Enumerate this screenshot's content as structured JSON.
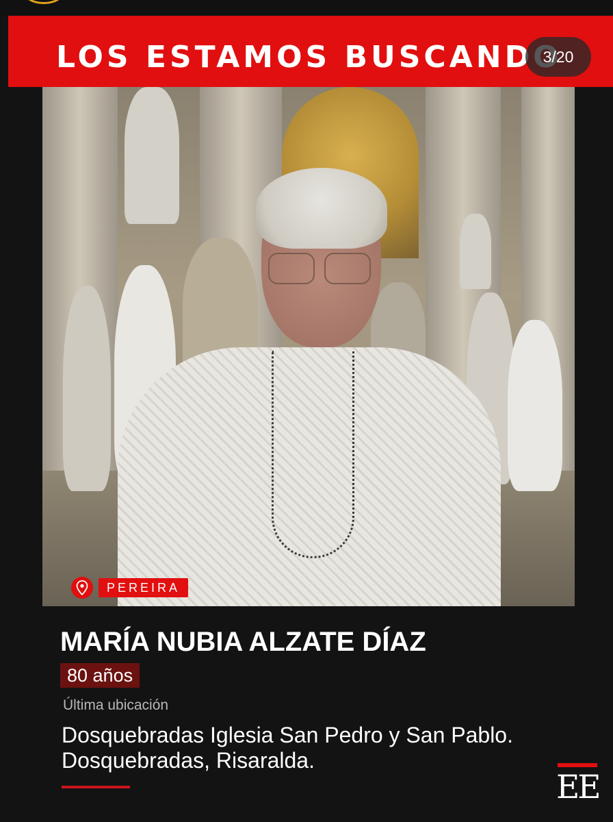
{
  "banner": {
    "title": "LOS ESTAMOS BUSCANDO"
  },
  "gallery": {
    "counter": "3/20"
  },
  "location": {
    "city": "PEREIRA",
    "icon": "map-pin-icon"
  },
  "person": {
    "name": "MARÍA NUBIA ALZATE DÍAZ",
    "age": "80 años",
    "last_location_label": "Última ubicación",
    "last_location": "Dosquebradas Iglesia San Pedro y San Pablo. Dosquebradas, Risaralda."
  },
  "brand": {
    "logo_text": "EE"
  },
  "colors": {
    "accent": "#e10f0f",
    "background": "#131313",
    "age_badge": "#6b1210"
  }
}
